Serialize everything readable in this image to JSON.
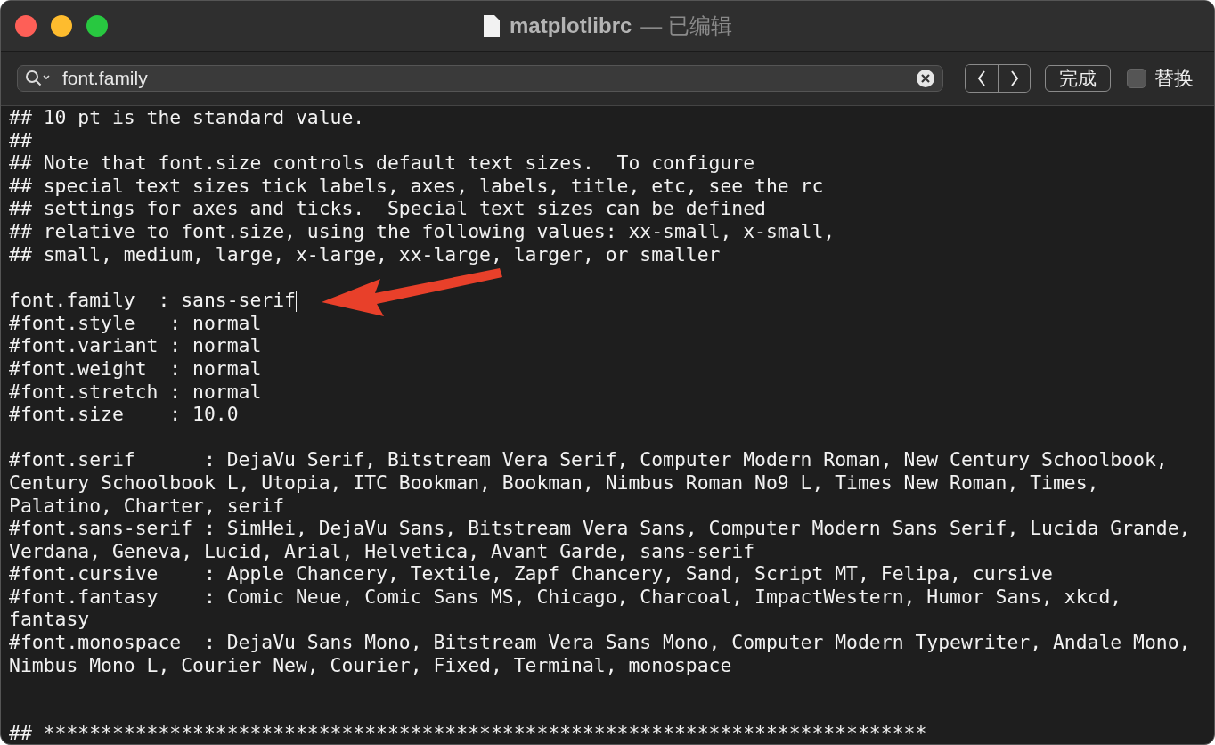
{
  "window": {
    "title": "matplotlibrc",
    "status": "— 已编辑"
  },
  "find_bar": {
    "query": "font.family",
    "done_button": "完成",
    "replace": {
      "label": "替换",
      "checked": false
    }
  },
  "editor": {
    "lines": [
      {
        "kind": "text",
        "text": "## 10 pt is the standard value.",
        "cursor": false
      },
      {
        "kind": "text",
        "text": "##",
        "cursor": false
      },
      {
        "kind": "text",
        "text": "## Note that font.size controls default text sizes.  To configure",
        "cursor": false
      },
      {
        "kind": "text",
        "text": "## special text sizes tick labels, axes, labels, title, etc, see the rc",
        "cursor": false
      },
      {
        "kind": "text",
        "text": "## settings for axes and ticks.  Special text sizes can be defined",
        "cursor": false
      },
      {
        "kind": "text",
        "text": "## relative to font.size, using the following values: xx-small, x-small,",
        "cursor": false
      },
      {
        "kind": "text",
        "text": "## small, medium, large, x-large, xx-large, larger, or smaller",
        "cursor": false
      },
      {
        "kind": "blank"
      },
      {
        "kind": "text",
        "text": "font.family  : sans-serif",
        "cursor": true
      },
      {
        "kind": "text",
        "text": "#font.style   : normal",
        "cursor": false
      },
      {
        "kind": "text",
        "text": "#font.variant : normal",
        "cursor": false
      },
      {
        "kind": "text",
        "text": "#font.weight  : normal",
        "cursor": false
      },
      {
        "kind": "text",
        "text": "#font.stretch : normal",
        "cursor": false
      },
      {
        "kind": "text",
        "text": "#font.size    : 10.0",
        "cursor": false
      },
      {
        "kind": "blank"
      },
      {
        "kind": "text",
        "text": "#font.serif      : DejaVu Serif, Bitstream Vera Serif, Computer Modern Roman, New Century Schoolbook, Century Schoolbook L, Utopia, ITC Bookman, Bookman, Nimbus Roman No9 L, Times New Roman, Times, Palatino, Charter, serif",
        "cursor": false
      },
      {
        "kind": "text",
        "text": "#font.sans-serif : SimHei, DejaVu Sans, Bitstream Vera Sans, Computer Modern Sans Serif, Lucida Grande, Verdana, Geneva, Lucid, Arial, Helvetica, Avant Garde, sans-serif",
        "cursor": false
      },
      {
        "kind": "text",
        "text": "#font.cursive    : Apple Chancery, Textile, Zapf Chancery, Sand, Script MT, Felipa, cursive",
        "cursor": false
      },
      {
        "kind": "text",
        "text": "#font.fantasy    : Comic Neue, Comic Sans MS, Chicago, Charcoal, ImpactWestern, Humor Sans, xkcd, fantasy",
        "cursor": false
      },
      {
        "kind": "text",
        "text": "#font.monospace  : DejaVu Sans Mono, Bitstream Vera Sans Mono, Computer Modern Typewriter, Andale Mono, Nimbus Mono L, Courier New, Courier, Fixed, Terminal, monospace",
        "cursor": false
      },
      {
        "kind": "blank"
      },
      {
        "kind": "blank"
      },
      {
        "kind": "text",
        "text": "## *****************************************************************************",
        "cursor": false
      }
    ]
  }
}
